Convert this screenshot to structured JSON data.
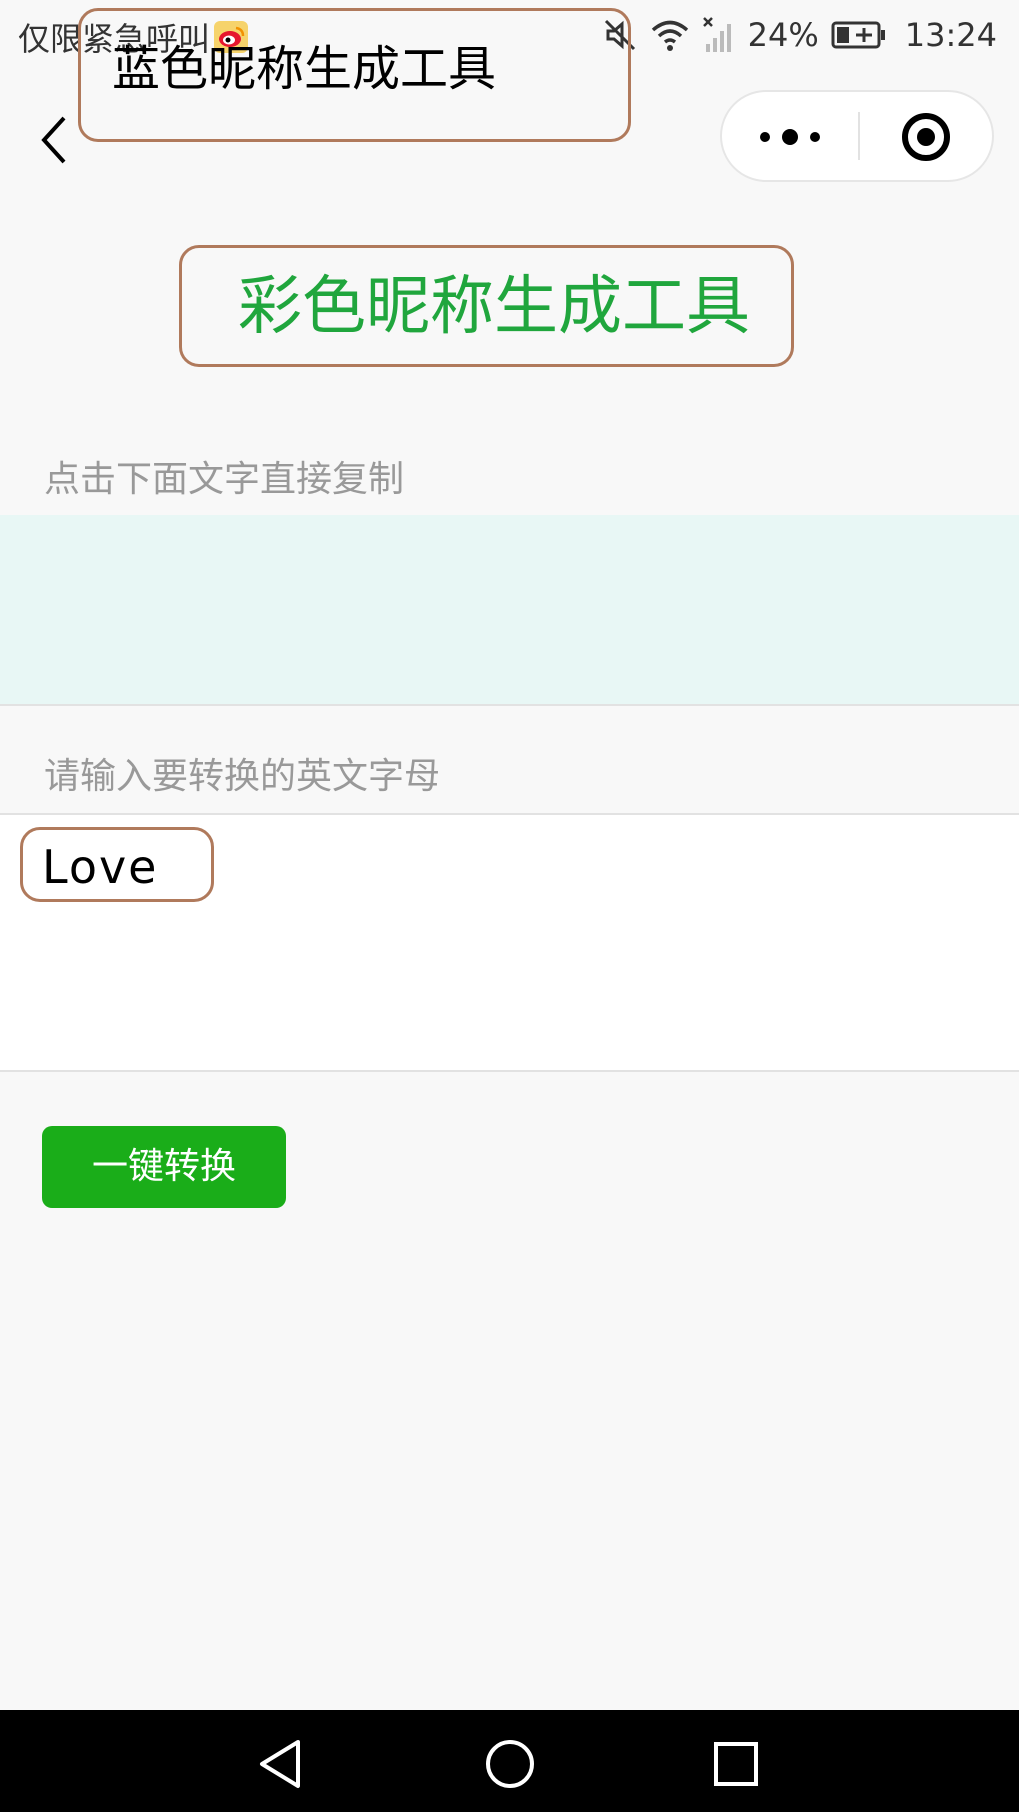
{
  "status_bar": {
    "carrier_text": "仅限紧急呼叫",
    "notification_icon": "weibo-icon",
    "icons": [
      "mute-icon",
      "wifi-icon",
      "signal-icon",
      "battery-charging-icon"
    ],
    "battery_percent": "24%",
    "time": "13:24"
  },
  "nav": {
    "back_icon": "chevron-left-icon",
    "title": "蓝色昵称生成工具",
    "capsule": {
      "more_icon": "more-dots-icon",
      "close_icon": "target-circle-icon"
    }
  },
  "main": {
    "heading": "彩色昵称生成工具",
    "heading_color": "#20a63d",
    "copy_hint": "点击下面文字直接复制",
    "result_text": "",
    "input_label": "请输入要转换的英文字母",
    "input_value": "Love",
    "convert_button_label": "一键转换",
    "button_color": "#1aad19"
  },
  "system_nav": {
    "icons": [
      "back-triangle-icon",
      "home-circle-icon",
      "recents-square-icon"
    ]
  }
}
